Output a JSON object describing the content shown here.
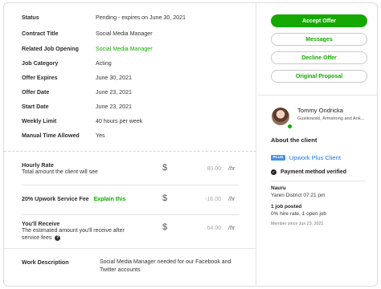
{
  "details": [
    {
      "label": "Status",
      "value": "Pending - expires on June 30, 2021"
    },
    {
      "label": "Contract Title",
      "value": "Social Media Manager"
    },
    {
      "label": "Related Job Opening",
      "value": "Social Media Manager"
    },
    {
      "label": "Job Category",
      "value": "Acting"
    },
    {
      "label": "Offer Expires",
      "value": "June 30, 2021"
    },
    {
      "label": "Offer Date",
      "value": "June 23, 2021"
    },
    {
      "label": "Start Date",
      "value": "June 23, 2021"
    },
    {
      "label": "Weekly Limit",
      "value": "40 hours per week"
    },
    {
      "label": "Manual Time Allowed",
      "value": "Yes"
    }
  ],
  "fees": {
    "hourly_rate": {
      "title": "Hourly Rate",
      "desc": "Total amount the client will see",
      "currency": "$",
      "amount": "80.00",
      "unit": "/hr"
    },
    "service_fee": {
      "title": "20% Upwork Service Fee",
      "link": "Explain this",
      "currency": "$",
      "amount": "-16.00",
      "unit": "/hr"
    },
    "receive": {
      "title": "You'll Receive",
      "desc": "The estimated amount you'll receive after service fees",
      "help": "?",
      "currency": "$",
      "amount": "64.00",
      "unit": "/hr"
    }
  },
  "work_description": {
    "label": "Work Description",
    "value": "Social Media Manager needed for our Facebook and Twitter accounts"
  },
  "actions": {
    "accept": "Accept Offer",
    "messages": "Messages",
    "decline": "Decline Offer",
    "original": "Original Proposal"
  },
  "client": {
    "name": "Tommy Ondricka",
    "company": "Gusikowski, Armstrong and Ank...",
    "about_heading": "About the client",
    "plus_badge": "PLUS",
    "plus_label": "Upwork Plus Client",
    "payment_verified": "Payment method verified",
    "country": "Nauru",
    "location_time": "Yaren District 07:21 pm",
    "jobs_posted": "1 job posted",
    "hire_rate": "0% hire rate, 1 open job",
    "member_since": "Member since Jun 23, 2021"
  },
  "colors": {
    "accent": "#14a800",
    "plus_blue": "#1a73e8"
  }
}
